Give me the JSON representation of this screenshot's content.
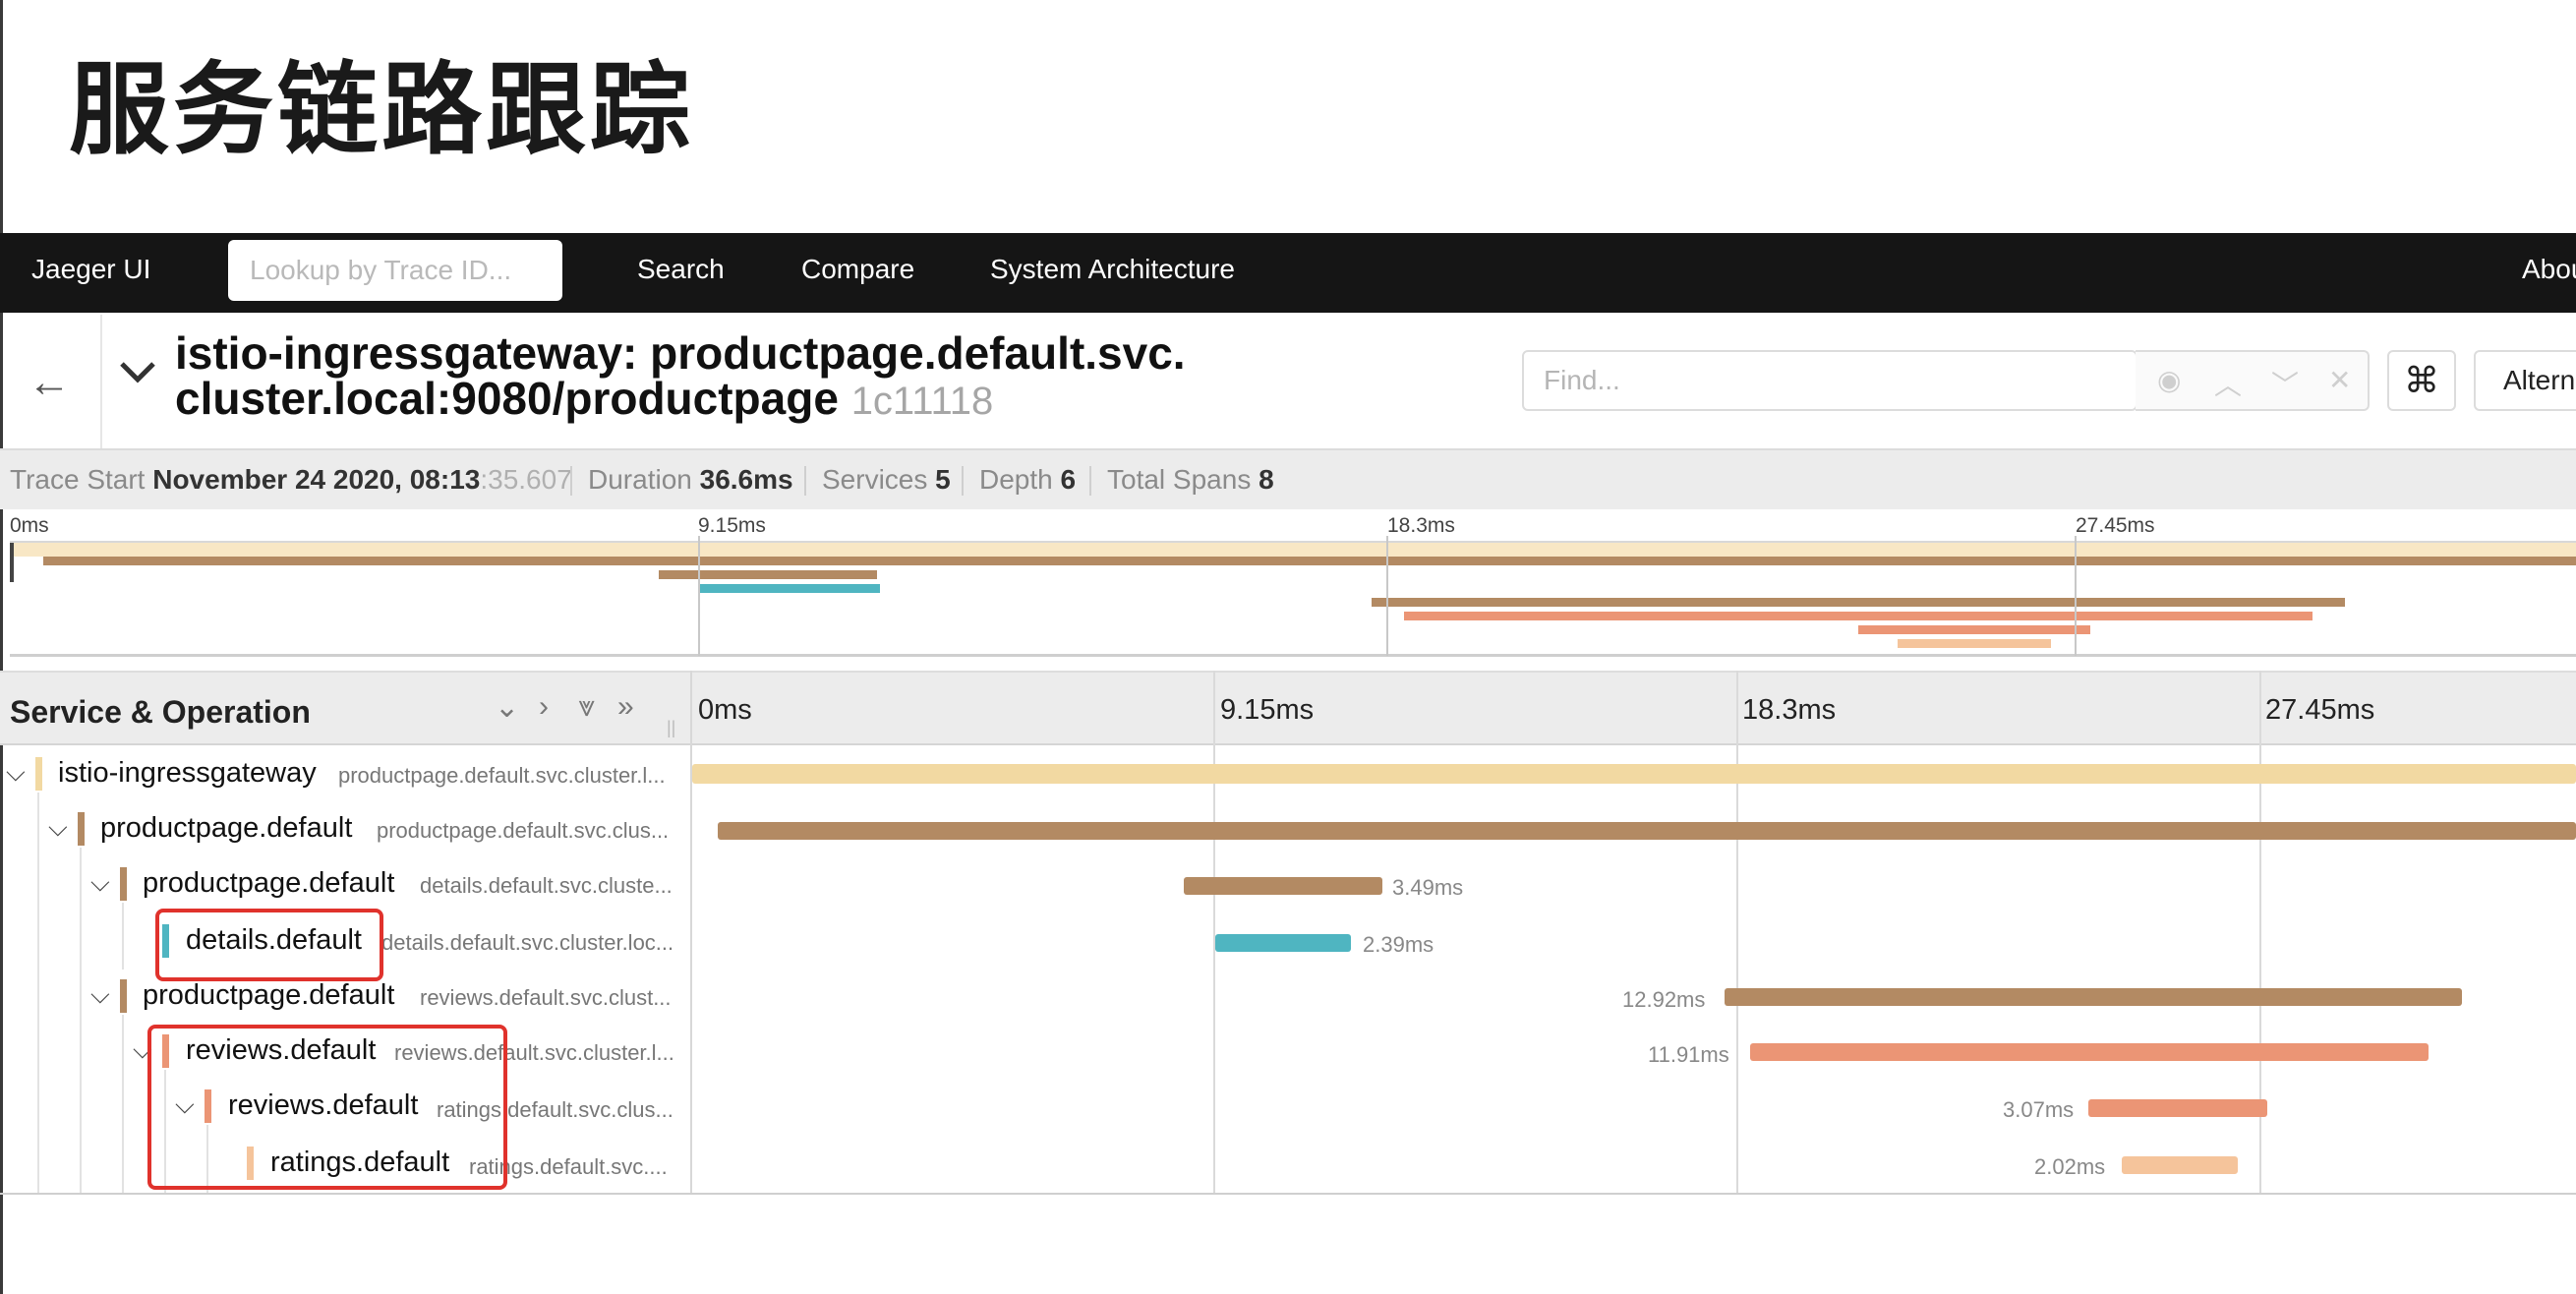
{
  "slide": {
    "title": "服务链路跟踪"
  },
  "nav": {
    "brand": "Jaeger UI",
    "lookup_placeholder": "Lookup by Trace ID...",
    "items": [
      "Search",
      "Compare",
      "System Architecture"
    ],
    "about": "About"
  },
  "trace": {
    "title_line1": "istio-ingressgateway: productpage.default.svc.",
    "title_line2": "cluster.local:9080/productpage",
    "id": "1c11118",
    "find_placeholder": "Find...",
    "cmd_symbol": "⌘",
    "alt_button": "Altern"
  },
  "meta": {
    "start_label": "Trace Start",
    "start_value": "November 24 2020, 08:13",
    "start_ms": ":35.607",
    "duration_label": "Duration",
    "duration_value": "36.6ms",
    "services_label": "Services",
    "services_value": "5",
    "depth_label": "Depth",
    "depth_value": "6",
    "spans_label": "Total Spans",
    "spans_value": "8"
  },
  "ticks": [
    "0ms",
    "9.15ms",
    "18.3ms",
    "27.45ms"
  ],
  "timeline": {
    "header": "Service & Operation"
  },
  "colors": {
    "ingress": "#f2d9a2",
    "productpage": "#b38a63",
    "details": "#4fb5c1",
    "reviews": "#eb9575",
    "ratings": "#f5c49b",
    "highlight": "#e0322c"
  },
  "rows": [
    {
      "service": "istio-ingressgateway",
      "operation": "productpage.default.svc.cluster.l...",
      "duration": ""
    },
    {
      "service": "productpage.default",
      "operation": "productpage.default.svc.clus...",
      "duration": ""
    },
    {
      "service": "productpage.default",
      "operation": "details.default.svc.cluste...",
      "duration": "3.49ms"
    },
    {
      "service": "details.default",
      "operation": "details.default.svc.cluster.loc...",
      "duration": "2.39ms"
    },
    {
      "service": "productpage.default",
      "operation": "reviews.default.svc.clust...",
      "duration": "12.92ms"
    },
    {
      "service": "reviews.default",
      "operation": "reviews.default.svc.cluster.l...",
      "duration": "11.91ms"
    },
    {
      "service": "reviews.default",
      "operation": "ratings.default.svc.clus...",
      "duration": "3.07ms"
    },
    {
      "service": "ratings.default",
      "operation": "ratings.default.svc....",
      "duration": "2.02ms"
    }
  ]
}
